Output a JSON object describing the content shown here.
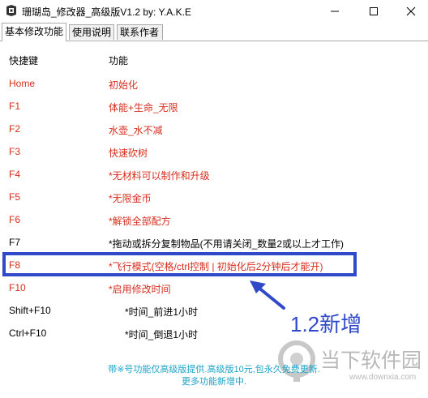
{
  "window": {
    "title": "珊瑚岛_修改器_高级版V1.2 by: Y.A.K.E"
  },
  "tabs": [
    {
      "label": "基本修改功能"
    },
    {
      "label": "使用说明"
    },
    {
      "label": "联系作者"
    }
  ],
  "table": {
    "headers": {
      "key": "快捷键",
      "function": "功能"
    },
    "rows": [
      {
        "key": "Home",
        "function": "初始化"
      },
      {
        "key": "F1",
        "function": "体能+生命_无限"
      },
      {
        "key": "F2",
        "function": "水壶_水不减"
      },
      {
        "key": "F3",
        "function": "快速砍树"
      },
      {
        "key": "F4",
        "function": "*无材料可以制作和升级"
      },
      {
        "key": "F5",
        "function": "*无限金币"
      },
      {
        "key": "F6",
        "function": "*解锁全部配方"
      },
      {
        "key": "F7",
        "function": "*拖动或拆分复制物品(不用请关闭_数量2或以上才工作)"
      },
      {
        "key": "F8",
        "function": "*飞行模式(空格/ctrl控制 | 初始化后2分钟后才能开)"
      },
      {
        "key": "F10",
        "function": "*启用修改时间"
      },
      {
        "key": "Shift+F10",
        "function": "*时间_前进1小时"
      },
      {
        "key": "Ctrl+F10",
        "function": "*时间_倒退1小时"
      }
    ]
  },
  "annotation": {
    "text": "1.2新增"
  },
  "footer": {
    "line1": "带※号功能仅高级版提供.高级版10元,包永久免费更新.",
    "line2": "更多功能新增中."
  },
  "watermark": {
    "brand": "当下软件园",
    "url": "www.downxia.com"
  },
  "colors": {
    "red_text": "#d62e1f",
    "highlight_blue": "#2f49c9",
    "footer_cyan": "#1ea3c8"
  }
}
